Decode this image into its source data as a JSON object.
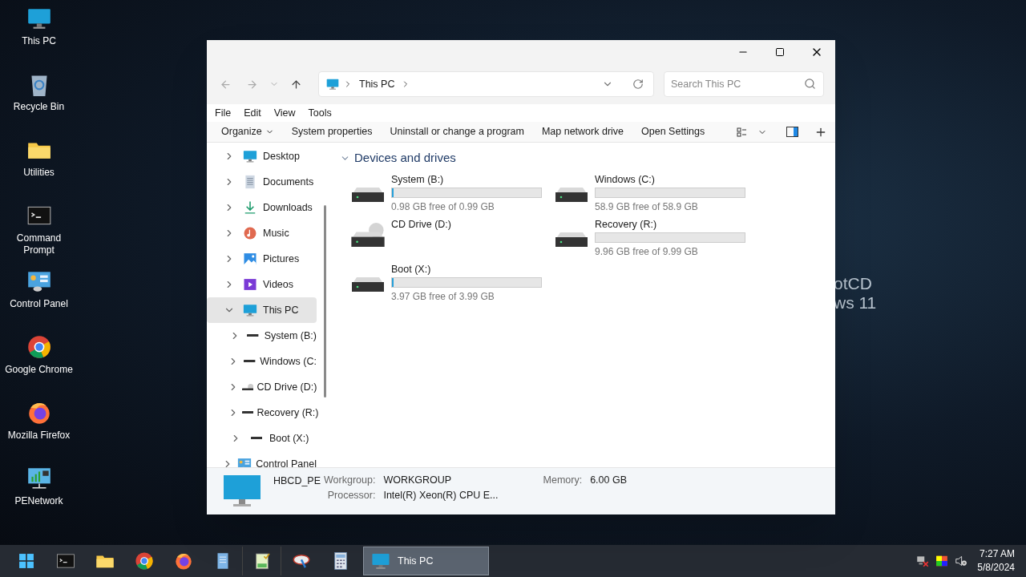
{
  "desktop": {
    "wallpaper_text": [
      "otCD",
      "ws 11"
    ],
    "icons": [
      {
        "label": "This PC",
        "kind": "pc"
      },
      {
        "label": "Recycle Bin",
        "kind": "bin"
      },
      {
        "label": "Utilities",
        "kind": "folder"
      },
      {
        "label": "Command Prompt",
        "kind": "terminal"
      },
      {
        "label": "Control Panel",
        "kind": "control"
      },
      {
        "label": "Google Chrome",
        "kind": "chrome"
      },
      {
        "label": "Mozilla Firefox",
        "kind": "firefox"
      },
      {
        "label": "PENetwork",
        "kind": "network"
      }
    ]
  },
  "window": {
    "address": "This PC",
    "search_placeholder": "Search This PC",
    "menu": [
      "File",
      "Edit",
      "View",
      "Tools"
    ],
    "commands": [
      {
        "label": "Organize",
        "dropdown": true
      },
      {
        "label": "System properties",
        "dropdown": false
      },
      {
        "label": "Uninstall or change a program",
        "dropdown": false
      },
      {
        "label": "Map network drive",
        "dropdown": false
      },
      {
        "label": "Open Settings",
        "dropdown": false
      }
    ],
    "nav": [
      {
        "label": "Desktop",
        "kind": "desktop",
        "selected": false,
        "expanded": false
      },
      {
        "label": "Documents",
        "kind": "documents",
        "selected": false,
        "expanded": false
      },
      {
        "label": "Downloads",
        "kind": "downloads",
        "selected": false,
        "expanded": false
      },
      {
        "label": "Music",
        "kind": "music",
        "selected": false,
        "expanded": false
      },
      {
        "label": "Pictures",
        "kind": "pictures",
        "selected": false,
        "expanded": false
      },
      {
        "label": "Videos",
        "kind": "videos",
        "selected": false,
        "expanded": false
      },
      {
        "label": "This PC",
        "kind": "pc",
        "selected": true,
        "expanded": true,
        "children": [
          {
            "label": "System (B:)",
            "kind": "drive",
            "selected": false,
            "expanded": false
          },
          {
            "label": "Windows (C:",
            "kind": "drive",
            "selected": false,
            "expanded": false
          },
          {
            "label": "CD Drive (D:)",
            "kind": "cd",
            "selected": false,
            "expanded": false
          },
          {
            "label": "Recovery (R:)",
            "kind": "drive",
            "selected": false,
            "expanded": false
          },
          {
            "label": "Boot (X:)",
            "kind": "drive",
            "selected": false,
            "expanded": false
          }
        ]
      },
      {
        "label": "Control Panel",
        "kind": "control",
        "selected": false,
        "expanded": false
      }
    ],
    "section": {
      "title": "Devices and drives",
      "expanded": true
    },
    "drives": [
      {
        "name": "System (B:)",
        "kind": "hdd",
        "level": 0.01,
        "free": "0.98 GB free of 0.99 GB"
      },
      {
        "name": "Windows (C:)",
        "kind": "hdd",
        "level": 0,
        "free": "58.9 GB free of 58.9 GB"
      },
      {
        "name": "CD Drive (D:)",
        "kind": "cd"
      },
      {
        "name": "Recovery (R:)",
        "kind": "hdd",
        "level": 0,
        "free": "9.96 GB free of 9.99 GB"
      },
      {
        "name": "Boot (X:)",
        "kind": "hdd",
        "level": 0.005,
        "free": "3.97 GB free of 3.99 GB"
      }
    ],
    "details": {
      "name": "HBCD_PE",
      "fields": [
        {
          "label": "Workgroup:",
          "value": "WORKGROUP"
        },
        {
          "label": "Memory:",
          "value": "6.00 GB"
        },
        {
          "label": "Processor:",
          "value": "Intel(R) Xeon(R) CPU E..."
        }
      ]
    }
  },
  "taskbar": {
    "apps": [
      {
        "kind": "start"
      },
      {
        "kind": "terminal"
      },
      {
        "kind": "folder"
      },
      {
        "kind": "chrome"
      },
      {
        "kind": "firefox"
      },
      {
        "kind": "notepad"
      },
      {
        "kind": "checklist"
      },
      {
        "kind": "tool"
      },
      {
        "kind": "calculator"
      }
    ],
    "window_button": {
      "label": "This PC",
      "selected": true
    },
    "tray": [
      {
        "kind": "network"
      },
      {
        "kind": "color"
      },
      {
        "kind": "speaker"
      }
    ],
    "clock": {
      "time": "7:27 AM",
      "date": "5/8/2024"
    }
  }
}
